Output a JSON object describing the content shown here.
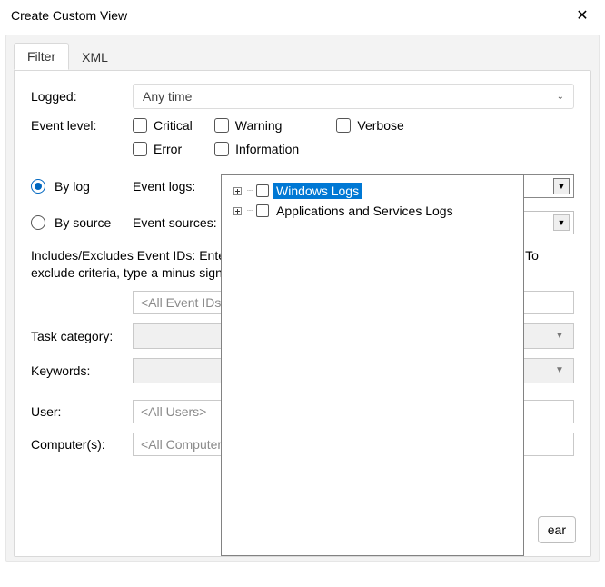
{
  "window": {
    "title": "Create Custom View",
    "close_glyph": "✕"
  },
  "tabs": {
    "filter": "Filter",
    "xml": "XML"
  },
  "labels": {
    "logged": "Logged:",
    "event_level": "Event level:",
    "by_log": "By log",
    "by_source": "By source",
    "event_logs": "Event logs:",
    "event_sources": "Event sources:",
    "includes_hint_a": "Includes/Excludes Event IDs: Ente",
    "includes_hint_b": "as. To exclude criteria, type a minus sign",
    "task_category": "Task category:",
    "keywords": "Keywords:",
    "user": "User:",
    "computers": "Computer(s):"
  },
  "values": {
    "logged_selected": "Any time",
    "event_ids_placeholder": "<All Event IDs>",
    "user_placeholder": "<All Users>",
    "computers_placeholder": "<All Computers>"
  },
  "checks": {
    "critical": "Critical",
    "warning": "Warning",
    "verbose": "Verbose",
    "error": "Error",
    "information": "Information"
  },
  "tree": {
    "item1": "Windows Logs",
    "item2": "Applications and Services Logs"
  },
  "buttons": {
    "clear": "ear"
  },
  "glyphs": {
    "chev_down": "⌄",
    "tri_down": "▼"
  }
}
